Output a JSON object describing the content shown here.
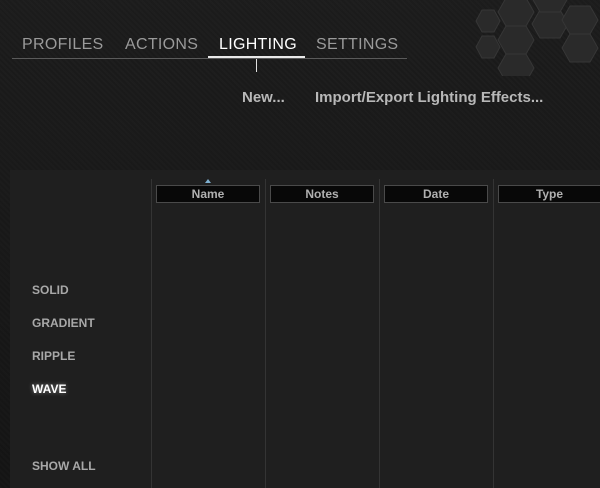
{
  "tabs": [
    {
      "label": "PROFILES"
    },
    {
      "label": "ACTIONS"
    },
    {
      "label": "LIGHTING",
      "active": true
    },
    {
      "label": "SETTINGS"
    }
  ],
  "actions": {
    "new_label": "New...",
    "import_export_label": "Import/Export Lighting Effects..."
  },
  "filters": [
    {
      "label": "SOLID"
    },
    {
      "label": "GRADIENT"
    },
    {
      "label": "RIPPLE"
    },
    {
      "label": "WAVE",
      "active": true
    },
    {
      "label": "SHOW ALL"
    }
  ],
  "table": {
    "columns": [
      "Name",
      "Notes",
      "Date",
      "Type"
    ],
    "sort_column": "Name",
    "rows": []
  },
  "colors": {
    "background": "#161616",
    "panel": "#1f1f1f",
    "active_text": "#ffffff",
    "inactive_text": "#9a9a9a",
    "sort_indicator": "#7fb0d0"
  },
  "icons": [
    "hexagon-decoration-icon",
    "sort-ascending-icon"
  ]
}
